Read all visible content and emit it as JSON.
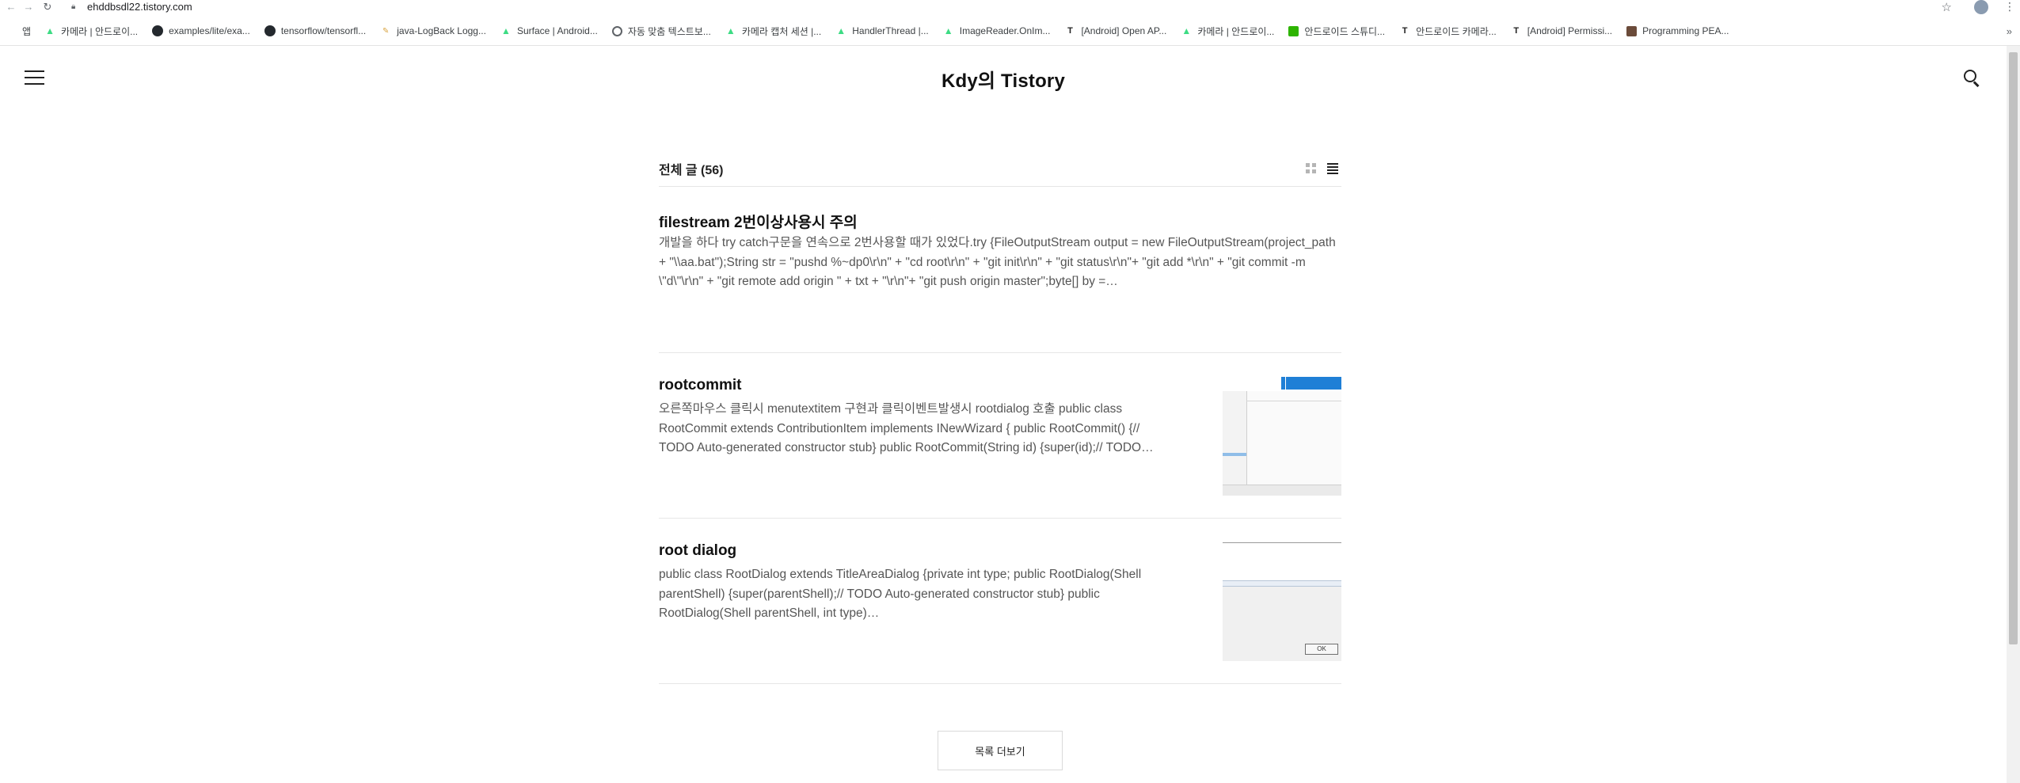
{
  "browser": {
    "url": "ehddbsdl22.tistory.com",
    "bookmarks": [
      {
        "label": "앱",
        "icon": "apps-icon"
      },
      {
        "label": "카메라 | 안드로이...",
        "icon": "android-icon"
      },
      {
        "label": "examples/lite/exa...",
        "icon": "github-icon"
      },
      {
        "label": "tensorflow/tensorfl...",
        "icon": "github-icon"
      },
      {
        "label": "java-LogBack Logg...",
        "icon": "logback-icon"
      },
      {
        "label": "Surface | Android...",
        "icon": "android-icon"
      },
      {
        "label": "자동 맞춤 텍스트보...",
        "icon": "globe-icon"
      },
      {
        "label": "카메라 캡처 세션 |...",
        "icon": "android-icon"
      },
      {
        "label": "HandlerThread |...",
        "icon": "android-icon"
      },
      {
        "label": "ImageReader.OnIm...",
        "icon": "android-icon"
      },
      {
        "label": "[Android] Open AP...",
        "icon": "tistory-icon"
      },
      {
        "label": "카메라 | 안드로이...",
        "icon": "android-icon"
      },
      {
        "label": "안드로이드 스튜디...",
        "icon": "green-square-icon"
      },
      {
        "label": "안드로이드 카메라...",
        "icon": "tistory-icon"
      },
      {
        "label": "[Android] Permissi...",
        "icon": "tistory-icon"
      },
      {
        "label": "Programming PEA...",
        "icon": "programming-icon"
      }
    ],
    "more_label": "»"
  },
  "blog": {
    "title": "Kdy의 Tistory"
  },
  "list": {
    "heading": "전체 글 (56)",
    "posts": [
      {
        "title": "filestream 2번이상사용시 주의",
        "excerpt": "개발을 하다 try catch구문을 연속으로 2번사용할 때가 있었다.try {FileOutputStream output = new FileOutputStream(project_path + \"\\\\aa.bat\");String str = \"pushd %~dp0\\r\\n\" + \"cd root\\r\\n\" + \"git init\\r\\n\" + \"git status\\r\\n\"+ \"git add *\\r\\n\" + \"git commit -m \\\"d\\\"\\r\\n\" + \"git remote add origin \" + txt + \"\\r\\n\"+ \"git push origin master\";byte[] by =…"
      },
      {
        "title": "rootcommit",
        "excerpt": "오른쪽마우스 클릭시 menutextitem 구현과 클릭이벤트발생시 rootdialog 호출 public class RootCommit extends ContributionItem implements INewWizard { public RootCommit() {// TODO Auto-generated constructor stub} public RootCommit(String id) {super(id);// TODO…"
      },
      {
        "title": "root dialog",
        "excerpt": "public class RootDialog extends TitleAreaDialog {private int type; public RootDialog(Shell parentShell) {super(parentShell);// TODO Auto-generated constructor stub} public RootDialog(Shell parentShell, int type)…",
        "thumb_button": "OK"
      }
    ],
    "more_button": "목록 더보기"
  }
}
